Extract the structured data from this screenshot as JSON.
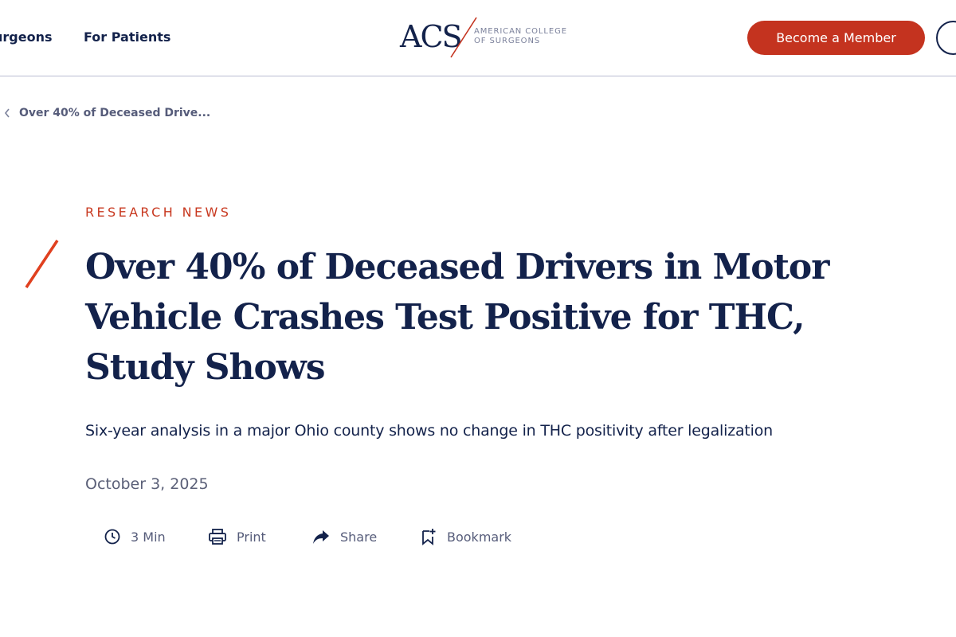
{
  "header": {
    "nav": [
      {
        "label": "urgeons"
      },
      {
        "label": "For Patients"
      }
    ],
    "logo": {
      "mark": "ACS",
      "line1": "AMERICAN COLLEGE",
      "line2": "OF SURGEONS"
    },
    "cta_label": "Become a Member"
  },
  "breadcrumb": {
    "label": "Over 40% of Deceased Drive..."
  },
  "article": {
    "eyebrow": "RESEARCH NEWS",
    "title": "Over 40% of Deceased Drivers in Motor Vehicle Crashes Test Positive for THC, Study Shows",
    "subtitle": "Six-year analysis in a major Ohio county shows no change in THC positivity after legalization",
    "date": "October 3, 2025",
    "actions": {
      "time": "3 Min",
      "print": "Print",
      "share": "Share",
      "bookmark": "Bookmark"
    }
  },
  "colors": {
    "navy": "#13224b",
    "accent_red": "#c4331f",
    "muted": "#565c7a"
  }
}
